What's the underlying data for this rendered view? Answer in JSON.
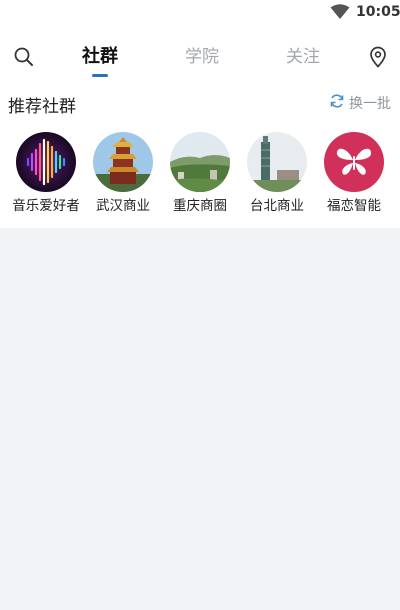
{
  "status_bar": {
    "time": "10:05",
    "wifi_icon": "wifi-icon"
  },
  "header": {
    "tabs": [
      {
        "label": "社群",
        "active": true
      },
      {
        "label": "学院",
        "active": false
      },
      {
        "label": "关注",
        "active": false
      }
    ],
    "search_icon": "search-icon",
    "location_icon": "location-pin-icon",
    "accent_color": "#2d6fc7"
  },
  "recommend": {
    "title": "推荐社群",
    "refresh_label": "换一批",
    "communities": [
      {
        "name": "音乐爱好者"
      },
      {
        "name": "武汉商业"
      },
      {
        "name": "重庆商圈"
      },
      {
        "name": "台北商业"
      },
      {
        "name": "福恋智能"
      }
    ]
  }
}
